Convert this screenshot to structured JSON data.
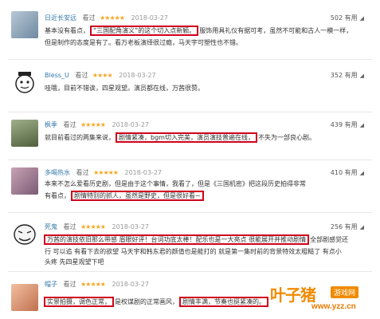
{
  "reviews": [
    {
      "user": "日近长安远",
      "status": "看过",
      "stars": "★★★★★",
      "date": "2018-03-27",
      "useful": "502 有用",
      "lines": [
        [
          "基本没有看点，",
          "“三国配角演义”的这个切入点新颖。",
          "服饰用具礼仪有据可考，虽然不可能和古人一模一样，"
        ],
        [
          "但是制作的态度是有了。看万老板演绎很过瘾，马天宇可塑性也不错。"
        ]
      ]
    },
    {
      "user": "Bless_U",
      "status": "看过",
      "stars": "★★★★",
      "date": "2018-03-27",
      "useful": "352 有用",
      "lines": [
        [
          "哇哦，目前不错诶，四星观望。演员都在线，万茜很赞。"
        ]
      ]
    },
    {
      "user": "枫季",
      "status": "看过",
      "stars": "★★★★★",
      "date": "2018-03-27",
      "useful": "439 有用",
      "lines": [
        [
          "就目前看过的两集来说，",
          "剧情紧凑，bgm切入完美，演员演技普遍在线，",
          "不失为一部良心剧。"
        ]
      ]
    },
    {
      "user": "多喝热水",
      "status": "看过",
      "stars": "★★★★★",
      "date": "2018-03-27",
      "useful": "410 有用",
      "lines": [
        [
          "本来不怎么爱看历史剧，但是由于这个事情，我看了，但是《三国机密》把这段历史拍得非常"
        ],
        [
          "有看点，",
          "剧情特别的抓人，虽然是野史，但是很好看~"
        ]
      ]
    },
    {
      "user": "死鬼",
      "status": "看过",
      "stars": "★★★★★",
      "date": "2018-03-27",
      "useful": "256 有用",
      "lines": [
        [
          "万茜的演技依旧那么带感 眉眼好评！台词功底太棒！配乐也是一大亮点 很能展开并推动剧情",
          "全部剧感觉还"
        ],
        [
          "行 可以追 有看下去的欲望 马天宇和韩东君的颜值也是能打的 就是第一集时前的背景特效太粗糙了 有点小"
        ],
        [
          "头疼 先四星观望下吧"
        ]
      ]
    },
    {
      "user": "帽子",
      "status": "看过",
      "stars": "★★★★★",
      "date": "2018-03-27",
      "useful": "",
      "lines": [
        [
          "实景拍摄，调色正常，",
          "是权谋剧的正常画风，",
          "剧情丰满，节奏也挺紧凑的。"
        ]
      ]
    }
  ],
  "watermark": {
    "title": "叶子猪",
    "tag": "游戏网",
    "url": "www.yzz.cn"
  },
  "colors": {
    "highlight_box": "#d0021b",
    "username": "#3377aa",
    "star": "#f5a623",
    "watermark": "#f08a00"
  }
}
